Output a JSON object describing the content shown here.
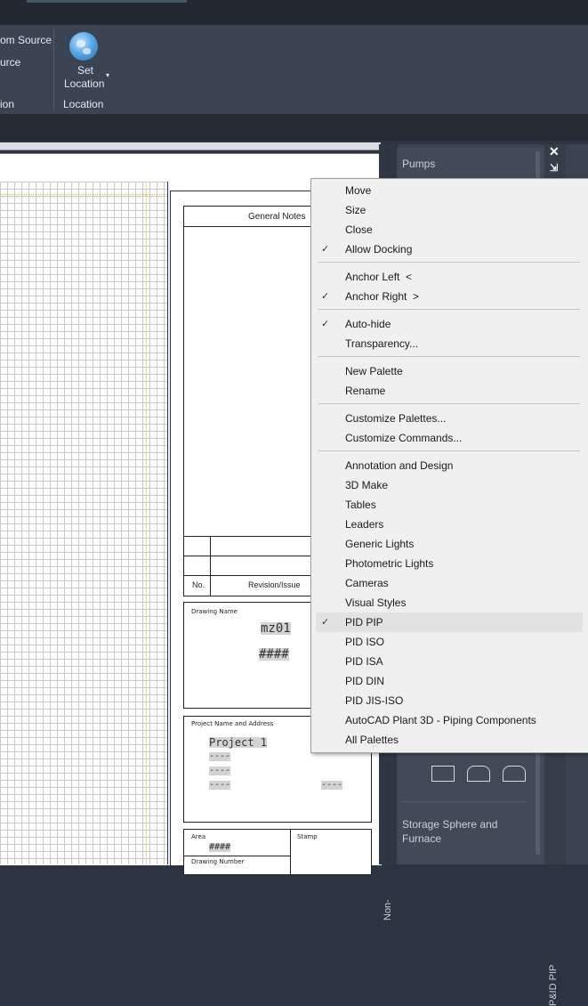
{
  "ribbon": {
    "partial_item_1": "om Source",
    "partial_item_2": "urce",
    "partial_panel_label": "ion",
    "set_location_line1": "Set",
    "set_location_line2": "Location",
    "location_panel_label": "Location"
  },
  "drawing": {
    "general_notes": "General Notes",
    "no_label": "No.",
    "revision_label": "Revision/Issue",
    "drawing_name_label": "Drawing Name",
    "drawing_name_value": "mz01",
    "drawing_name_hash": "####",
    "project_label": "Project Name and Address",
    "project_value": "Project 1",
    "dash1": "----",
    "dash2": "----",
    "dash3": "----",
    "dash4": "----",
    "area_label": "Area",
    "area_value": "####",
    "stamp_label": "Stamp",
    "drawing_number_label": "Drawing Number"
  },
  "palette": {
    "section_pumps": "Pumps",
    "section_storage_line1": "Storage Sphere and",
    "section_storage_line2": "Furnace",
    "side_tab_left": "Non-",
    "side_tab_right": "P&ID PIP",
    "close_icon": "close-icon",
    "properties_icon": "palette-properties-icon"
  },
  "context_menu": {
    "items": [
      {
        "label": "Move",
        "checked": false
      },
      {
        "label": "Size",
        "checked": false
      },
      {
        "label": "Close",
        "checked": false
      },
      {
        "label": "Allow Docking",
        "checked": true
      },
      {
        "label": "Anchor Left  <",
        "checked": false
      },
      {
        "label": "Anchor Right  >",
        "checked": true
      },
      {
        "label": "Auto-hide",
        "checked": true
      },
      {
        "label": "Transparency...",
        "checked": false
      },
      {
        "label": "New Palette",
        "checked": false
      },
      {
        "label": "Rename",
        "checked": false
      },
      {
        "label": "Customize Palettes...",
        "checked": false
      },
      {
        "label": "Customize Commands...",
        "checked": false
      },
      {
        "label": "Annotation and Design",
        "checked": false
      },
      {
        "label": "3D Make",
        "checked": false
      },
      {
        "label": "Tables",
        "checked": false
      },
      {
        "label": "Leaders",
        "checked": false
      },
      {
        "label": "Generic Lights",
        "checked": false
      },
      {
        "label": "Photometric Lights",
        "checked": false
      },
      {
        "label": "Cameras",
        "checked": false
      },
      {
        "label": "Visual Styles",
        "checked": false
      },
      {
        "label": "PID PIP",
        "checked": true,
        "highlighted": true
      },
      {
        "label": "PID ISO",
        "checked": false
      },
      {
        "label": "PID ISA",
        "checked": false
      },
      {
        "label": "PID DIN",
        "checked": false
      },
      {
        "label": "PID JIS-ISO",
        "checked": false
      },
      {
        "label": "AutoCAD Plant 3D - Piping Components",
        "checked": false
      },
      {
        "label": "All Palettes",
        "checked": false
      }
    ],
    "check_glyph": "✓"
  }
}
